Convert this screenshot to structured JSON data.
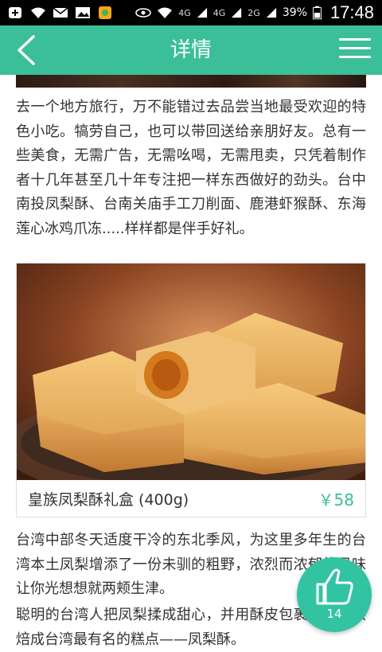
{
  "status_bar": {
    "network_1": "4G",
    "network_2": "4G",
    "network_3": "2G",
    "battery": "39%",
    "time": "17:48"
  },
  "header": {
    "title": "详情"
  },
  "article": {
    "paragraph_1": "去一个地方旅行，万不能错过去品尝当地最受欢迎的特色小吃。犒劳自己，也可以带回送给亲朋好友。总有一些美食，无需广告，无需吆喝，无需甩卖，只凭着制作者十几年甚至几十年专注把一样东西做好的劲头。台中南投凤梨酥、台南关庙手工刀削面、鹿港虾猴酥、东海莲心冰鸡爪冻.....样样都是伴手好礼。",
    "paragraph_2": "台湾中部冬天适度干冷的东北季风，为这里多年生的台湾本土凤梨增添了一份未驯的粗野，浓烈而浓郁的风味让你光想想就两颊生津。",
    "paragraph_3": "聪明的台湾人把凤梨揉成甜心，并用酥皮包裹，精心烘焙成台湾最有名的糕点——凤梨酥。"
  },
  "product": {
    "name": "皇族凤梨酥礼盒 (400g)",
    "price": "￥58"
  },
  "like_button": {
    "count": "14",
    "icon": "thumbs-up-icon"
  },
  "colors": {
    "accent": "#3bbf98",
    "like_bg": "#32c3a3"
  }
}
